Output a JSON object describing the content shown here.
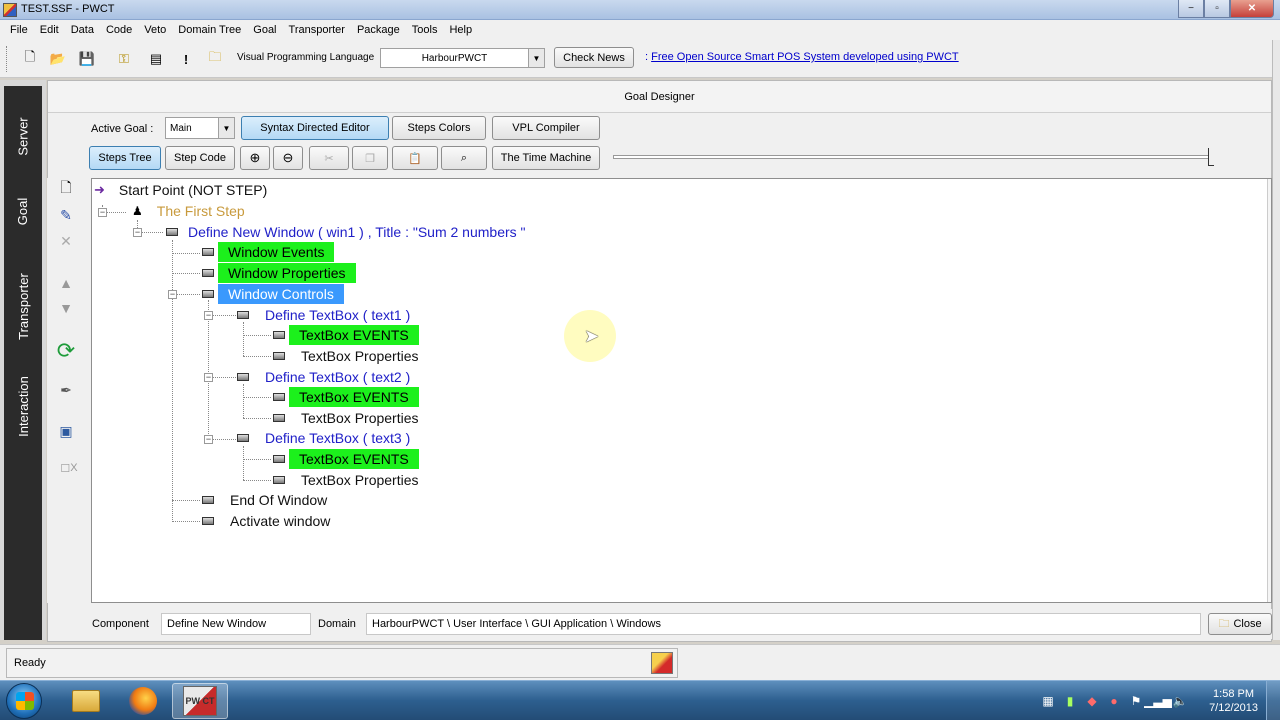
{
  "window": {
    "title": "TEST.SSF - PWCT",
    "min": "−",
    "max": "▫",
    "close": "✕"
  },
  "menu": [
    "File",
    "Edit",
    "Data",
    "Code",
    "Veto",
    "Domain Tree",
    "Goal",
    "Transporter",
    "Package",
    "Tools",
    "Help"
  ],
  "toolbar": {
    "vpl_label": "Visual Programming Language",
    "vpl_value": "HarbourPWCT",
    "check_news": "Check News",
    "news_prefix": ":",
    "news_link": "Free Open Source Smart POS System developed using PWCT"
  },
  "sidebar": {
    "tabs": [
      "Server",
      "Goal",
      "Transporter",
      "Interaction"
    ]
  },
  "designer": {
    "header": "Goal Designer",
    "active_goal_label": "Active Goal :",
    "active_goal_value": "Main",
    "syntax_editor": "Syntax Directed Editor",
    "steps_colors": "Steps Colors",
    "vpl_compiler": "VPL Compiler",
    "steps_tree": "Steps Tree",
    "step_code": "Step Code",
    "time_machine": "The Time Machine"
  },
  "tree": {
    "start": "Start Point (NOT STEP)",
    "first_step": "The First Step",
    "define_window": "Define New Window  ( win1 ) , Title : \"Sum 2 numbers  \"",
    "window_events": "Window Events",
    "window_properties": "Window Properties",
    "window_controls": "Window Controls",
    "textbox1": "Define TextBox  ( text1  )",
    "textbox2": "Define TextBox  ( text2  )",
    "textbox3": "Define TextBox  ( text3  )",
    "tb_events": "TextBox EVENTS",
    "tb_props": "TextBox Properties",
    "end_window": "End Of Window",
    "activate_window": "Activate window"
  },
  "bottom": {
    "component_label": "Component",
    "component_value": "Define New Window",
    "domain_label": "Domain",
    "domain_value": "HarbourPWCT  \\  User Interface  \\  GUI Application  \\  Windows",
    "close": "Close"
  },
  "status": {
    "text": "Ready"
  },
  "tool_x": "X",
  "taskbar": {
    "time": "1:58 PM",
    "date": "7/12/2013",
    "pwct_label": "PW CT"
  },
  "colors": {
    "step_green": "#1cf01c",
    "selected": "#3a99fd",
    "step_blue": "#2121c8",
    "step_gold": "#c89a3c"
  }
}
